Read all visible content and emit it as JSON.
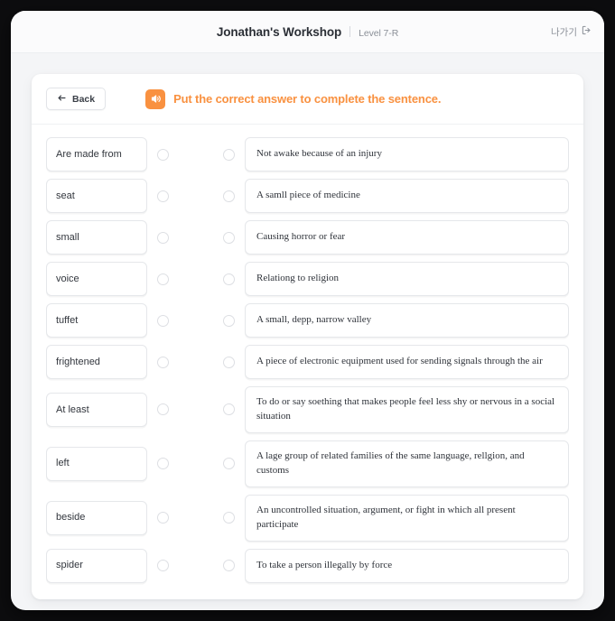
{
  "header": {
    "app_title": "Jonathan's Workshop",
    "level_label": "Level 7-R",
    "exit_label": "나가기",
    "exit_icon": "logout-icon"
  },
  "card": {
    "back_label": "Back",
    "back_icon": "arrow-left-icon",
    "sound_icon": "speaker-icon",
    "instruction": "Put the correct answer to complete the sentence.",
    "accent_color": "#f99140"
  },
  "match_rows": [
    {
      "term": "Are made from",
      "definition": "Not awake because of an injury"
    },
    {
      "term": "seat",
      "definition": "A samll piece of medicine"
    },
    {
      "term": "small",
      "definition": "Causing horror or fear"
    },
    {
      "term": "voice",
      "definition": "Relationg to religion"
    },
    {
      "term": "tuffet",
      "definition": "A small, depp, narrow valley"
    },
    {
      "term": "frightened",
      "definition": "A piece of electronic equipment used for sending signals through the air"
    },
    {
      "term": "At least",
      "definition": "To do or say soething that makes people feel less shy or nervous in a social situation"
    },
    {
      "term": "left",
      "definition": "A lage group of related families of the same language, rellgion, and customs"
    },
    {
      "term": "beside",
      "definition": "An uncontrolled situation, argument, or fight in which all present participate"
    },
    {
      "term": "spider",
      "definition": "To take a person illegally by force"
    }
  ]
}
